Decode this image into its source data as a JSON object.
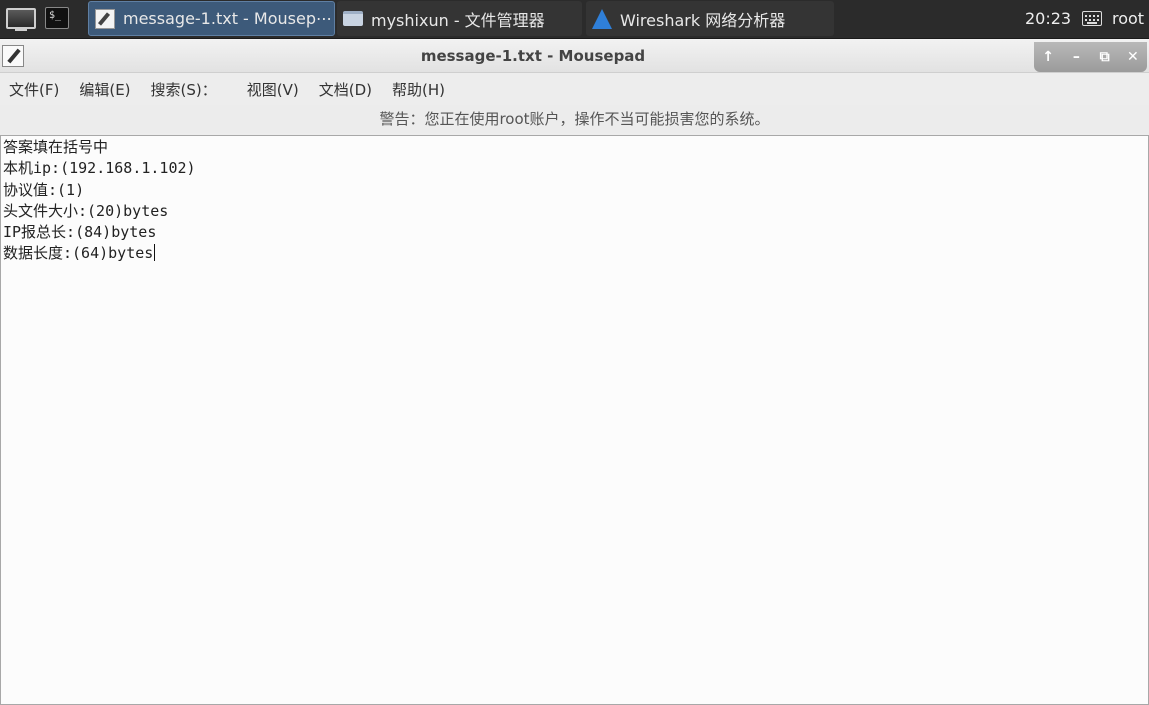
{
  "taskbar": {
    "tasks": [
      {
        "label": "message-1.txt - Mousep⋯",
        "icon": "mousepad-icon",
        "active": true
      },
      {
        "label": "myshixun - 文件管理器",
        "icon": "folder-icon",
        "active": false
      },
      {
        "label": "Wireshark 网络分析器",
        "icon": "wireshark-icon",
        "active": false
      }
    ],
    "clock": "20:23",
    "user": "root",
    "terminal_glyph": "$_"
  },
  "window": {
    "title": "message-1.txt - Mousepad",
    "controls": {
      "shade": "↑",
      "minimize": "–",
      "maximize": "⧉",
      "close": "✕"
    }
  },
  "menubar": {
    "items": [
      "文件(F)",
      "编辑(E)",
      "搜索(S)：",
      "视图(V)",
      "文档(D)",
      "帮助(H)"
    ]
  },
  "warning": "警告：您正在使用root账户，操作不当可能损害您的系统。",
  "editor": {
    "lines": [
      "答案填在括号中",
      "本机ip:(192.168.1.102)",
      "协议值:(1)",
      "头文件大小:(20)bytes",
      "IP报总长:(84)bytes",
      "数据长度:(64)bytes"
    ]
  }
}
